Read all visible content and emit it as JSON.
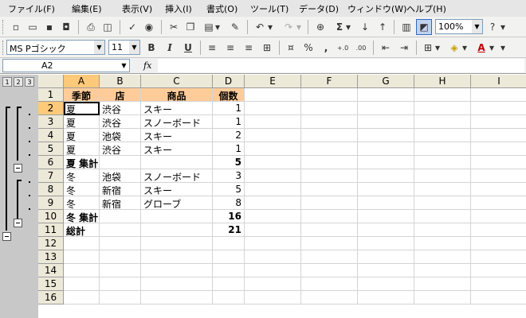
{
  "menu": [
    "ファイル(F)",
    "編集(E)",
    "表示(V)",
    "挿入(I)",
    "書式(O)",
    "ツール(T)",
    "データ(D)",
    "ウィンドウ(W)",
    "ヘルプ(H)"
  ],
  "toolbar": {
    "zoom": "100%",
    "font_name": "MS Pゴシック",
    "font_size": "11",
    "bold_label": "B",
    "italic_label": "I",
    "underline_label": "U",
    "autosum_label": "Σ",
    "percent_label": "%",
    "comma_label": ",",
    "inc_decimal_label": "+.0",
    "dec_decimal_label": ".00"
  },
  "formula_bar": {
    "name_box": "A2",
    "fx_label": "fx",
    "formula": ""
  },
  "outline": {
    "levels": [
      "1",
      "2",
      "3"
    ]
  },
  "columns": [
    "A",
    "B",
    "C",
    "D",
    "E",
    "F",
    "G",
    "H",
    "I"
  ],
  "rows": [
    "1",
    "2",
    "3",
    "4",
    "5",
    "6",
    "7",
    "8",
    "9",
    "10",
    "11",
    "12",
    "13",
    "14",
    "15",
    "16"
  ],
  "cells": [
    [
      "季節",
      "店",
      "商品",
      "個数"
    ],
    [
      "夏",
      "渋谷",
      "スキー",
      "1"
    ],
    [
      "夏",
      "渋谷",
      "スノーボード",
      "1"
    ],
    [
      "夏",
      "池袋",
      "スキー",
      "2"
    ],
    [
      "夏",
      "渋谷",
      "スキー",
      "1"
    ],
    [
      "夏 集計",
      "",
      "",
      "5"
    ],
    [
      "冬",
      "池袋",
      "スノーボード",
      "3"
    ],
    [
      "冬",
      "新宿",
      "スキー",
      "5"
    ],
    [
      "冬",
      "新宿",
      "グローブ",
      "8"
    ],
    [
      "冬 集計",
      "",
      "",
      "16"
    ],
    [
      "総計",
      "",
      "",
      "21"
    ],
    [
      "",
      "",
      "",
      ""
    ],
    [
      "",
      "",
      "",
      ""
    ],
    [
      "",
      "",
      "",
      ""
    ],
    [
      "",
      "",
      "",
      ""
    ],
    [
      "",
      "",
      "",
      ""
    ]
  ],
  "selection": {
    "active_cell": "A2"
  },
  "colors": {
    "header_fill": "#ffcc99",
    "selected_header": "#ffc97a",
    "outline_pane": "#c8c8c8"
  }
}
